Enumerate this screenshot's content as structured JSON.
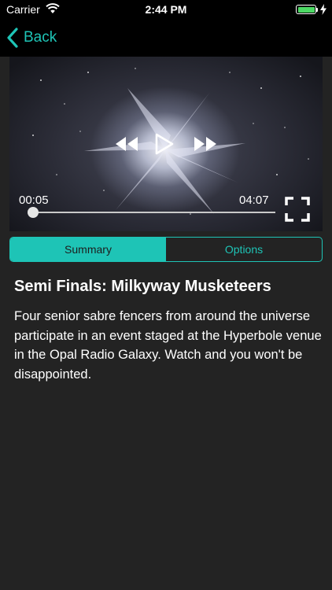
{
  "status_bar": {
    "carrier": "Carrier",
    "time": "2:44 PM",
    "battery_color": "#4cd964",
    "icons": [
      "wifi-icon",
      "battery-icon",
      "charging-bolt-icon"
    ]
  },
  "nav": {
    "back_label": "Back",
    "accent_color": "#1ec4b6",
    "back_icon": "chevron-left-icon"
  },
  "player": {
    "current_time": "00:05",
    "duration": "04:07",
    "progress": 0.02,
    "icons": [
      "rewind-icon",
      "play-icon",
      "fast-forward-icon",
      "fullscreen-icon"
    ]
  },
  "tabs": [
    {
      "label": "Summary",
      "selected": true
    },
    {
      "label": "Options",
      "selected": false
    }
  ],
  "content": {
    "title": "Semi Finals: Milkyway Musketeers",
    "description": "Four senior sabre fencers from around the universe participate in an event staged at the Hyperbole venue in the Opal Radio Galaxy. Watch and you won't be disappointed."
  }
}
